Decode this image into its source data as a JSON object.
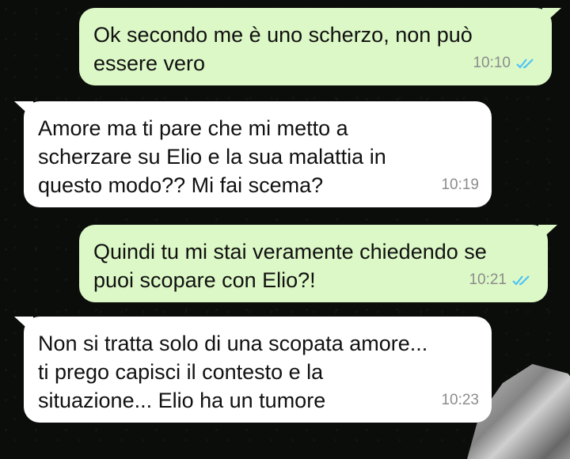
{
  "messages": [
    {
      "direction": "outgoing",
      "text": "Ok secondo me è uno scherzo, non può\nessere vero",
      "time": "10:10",
      "status_icon": "double-check-read-icon"
    },
    {
      "direction": "incoming",
      "text": "Amore ma ti pare che mi metto a\nscherzare su Elio e la sua malattia in\nquesto modo?? Mi fai scema?",
      "time": "10:19"
    },
    {
      "direction": "outgoing",
      "text": "Quindi tu mi stai veramente chiedendo se\npuoi scopare con Elio?!",
      "time": "10:21",
      "status_icon": "double-check-read-icon"
    },
    {
      "direction": "incoming",
      "text": "Non si tratta solo di una scopata amore...\nti prego capisci il contesto e la\nsituazione... Elio ha un tumore",
      "time": "10:23"
    }
  ],
  "colors": {
    "outgoing_bubble": "#dcf8c6",
    "incoming_bubble": "#ffffff",
    "read_tick": "#4fc3f7",
    "background": "#0b0d0b"
  }
}
